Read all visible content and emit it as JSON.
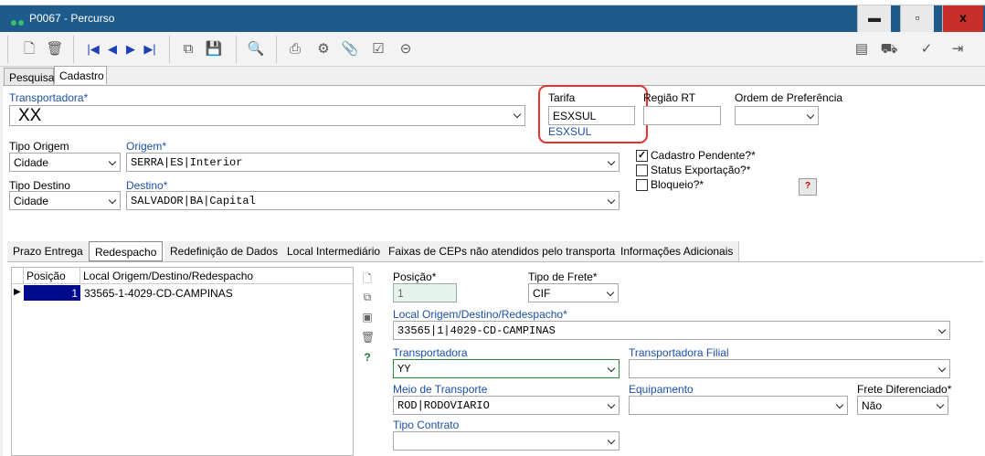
{
  "window": {
    "title": "P0067 - Percurso",
    "minimize": "–",
    "maximize": "▫",
    "close": "x"
  },
  "toolbar": {
    "icons": [
      "new-icon",
      "delete-icon",
      "first-record-icon",
      "prev-record-icon",
      "next-record-icon",
      "last-record-icon",
      "copy-icon",
      "save-icon",
      "search-tool-icon",
      "print-icon",
      "settings-icon",
      "attach-icon",
      "check-icon",
      "link-icon",
      "report-icon",
      "truck-icon",
      "confirm-icon",
      "exit-icon"
    ]
  },
  "tabs_top": [
    "Pesquisa",
    "Cadastro"
  ],
  "form": {
    "transportadora_label": "Transportadora*",
    "transportadora_value": "XX",
    "tarifa_label": "Tarifa",
    "tarifa_value": "ESXSUL",
    "tarifa_link": "ESXSUL",
    "regiao_rt_label": "Região RT",
    "regiao_rt_value": "",
    "ordem_label": "Ordem de Preferência",
    "ordem_value": "",
    "tipo_origem_label": "Tipo Origem",
    "tipo_origem_value": "Cidade",
    "origem_label": "Origem*",
    "origem_value": "SERRA|ES|Interior",
    "tipo_destino_label": "Tipo Destino",
    "tipo_destino_value": "Cidade",
    "destino_label": "Destino*",
    "destino_value": "SALVADOR|BA|Capital",
    "cadastro_pendente_label": "Cadastro Pendente?*",
    "status_exportacao_label": "Status Exportação?*",
    "bloqueio_label": "Bloqueio?*",
    "help_button": "?"
  },
  "tabs_sub": [
    "Prazo Entrega",
    "Redespacho",
    "Redefinição de Dados",
    "Local Intermediário",
    "Faixas de CEPs não atendidos pelo transportador",
    "Informações Adicionais"
  ],
  "grid": {
    "headers": [
      "Posição",
      "Local Origem/Destino/Redespacho"
    ],
    "rows": [
      {
        "posicao": "1",
        "local": "33565-1-4029-CD-CAMPINAS"
      }
    ]
  },
  "detail": {
    "posicao_label": "Posição*",
    "posicao_value": "1",
    "tipo_frete_label": "Tipo de Frete*",
    "tipo_frete_value": "CIF",
    "local_label": "Local Origem/Destino/Redespacho*",
    "local_value": "33565|1|4029-CD-CAMPINAS",
    "transportadora_label": "Transportadora",
    "transportadora_value": "YY",
    "transportadora_filial_label": "Transportadora Filial",
    "transportadora_filial_value": "",
    "meio_label": "Meio de Transporte",
    "meio_value": "ROD|RODOVIARIO",
    "equipamento_label": "Equipamento",
    "equipamento_value": "",
    "frete_dif_label": "Frete Diferenciado*",
    "frete_dif_value": "Não",
    "tipo_contrato_label": "Tipo Contrato",
    "tipo_contrato_value": ""
  }
}
